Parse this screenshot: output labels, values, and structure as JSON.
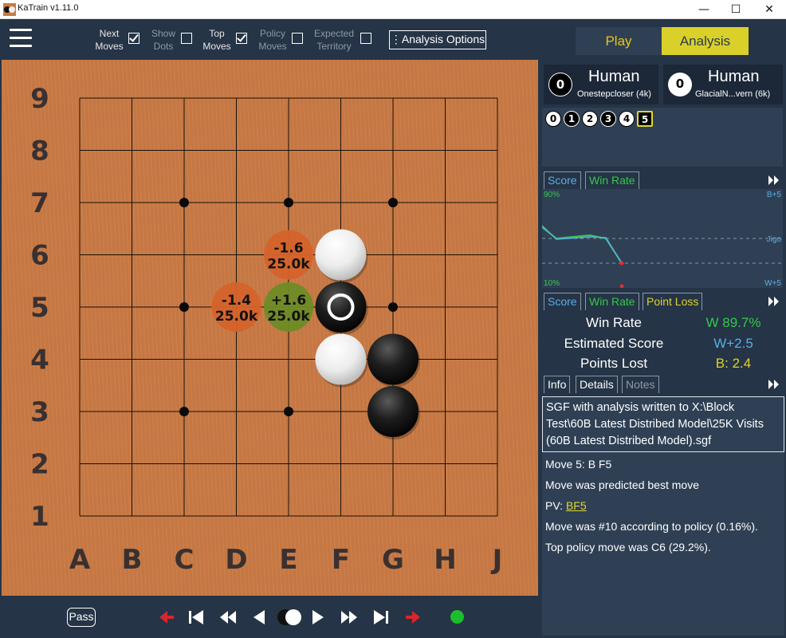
{
  "window": {
    "title": "KaTrain v1.11.0",
    "minimize": "—",
    "maximize": "☐",
    "close": "✕"
  },
  "toolbar": {
    "toggles": [
      {
        "line1": "Next",
        "line2": "Moves",
        "checked": true
      },
      {
        "line1": "Show",
        "line2": "Dots",
        "checked": false
      },
      {
        "line1": "Top",
        "line2": "Moves",
        "checked": true
      },
      {
        "line1": "Policy",
        "line2": "Moves",
        "checked": false
      },
      {
        "line1": "Expected",
        "line2": "Territory",
        "checked": false
      }
    ],
    "analysis_options": "⋮Analysis Options",
    "mode_tabs": {
      "play": "Play",
      "analysis": "Analysis"
    }
  },
  "board": {
    "size": 9,
    "col_labels": [
      "A",
      "B",
      "C",
      "D",
      "E",
      "F",
      "G",
      "H",
      "J"
    ],
    "row_labels": [
      "9",
      "8",
      "7",
      "6",
      "5",
      "4",
      "3",
      "2",
      "1"
    ],
    "star_points": [
      "C7",
      "E7",
      "G7",
      "C5",
      "G5",
      "C3",
      "E3"
    ],
    "stones": [
      {
        "point": "F6",
        "color": "white"
      },
      {
        "point": "F5",
        "color": "black",
        "last_move": true
      },
      {
        "point": "F4",
        "color": "white"
      },
      {
        "point": "G4",
        "color": "black"
      },
      {
        "point": "G3",
        "color": "black"
      }
    ],
    "candidate_moves": [
      {
        "point": "E6",
        "score": "-1.6",
        "visits": "25.0k",
        "color": "#d5632b"
      },
      {
        "point": "D5",
        "score": "-1.4",
        "visits": "25.0k",
        "color": "#d5632b"
      },
      {
        "point": "E5",
        "score": "+1.6",
        "visits": "25.0k",
        "color": "#6d8c26"
      }
    ]
  },
  "bottom": {
    "pass": "Pass"
  },
  "players": {
    "black": {
      "captures": "0",
      "type": "Human",
      "name": "Onestepcloser (4k)"
    },
    "white": {
      "captures": "0",
      "type": "Human",
      "name": "GlacialN...vern (6k)"
    }
  },
  "move_tree": [
    "0",
    "1",
    "2",
    "3",
    "4",
    "5"
  ],
  "graph": {
    "tabs": [
      "Score",
      "Win Rate"
    ],
    "top_left": "90%",
    "bottom_left": "10%",
    "top_right": "B+5",
    "mid_right": "Jigo",
    "bottom_right": "W+5"
  },
  "stats": {
    "tabs": [
      "Score",
      "Win Rate",
      "Point Loss"
    ],
    "rows": [
      {
        "label": "Win Rate",
        "value": "W 89.7%",
        "color": "#35c84a"
      },
      {
        "label": "Estimated Score",
        "value": "W+2.5",
        "color": "#5aaee6"
      },
      {
        "label": "Points Lost",
        "value": "B: 2.4",
        "color": "#e0d32a"
      }
    ]
  },
  "info": {
    "tabs": [
      "Info",
      "Details",
      "Notes"
    ],
    "sgf_message": "SGF with analysis written to X:\\Block Test\\60B Latest Distribed Model\\25K Visits (60B Latest Distribed Model).sgf",
    "move_line": "Move 5: B F5",
    "predicted": "Move was predicted best move",
    "pv_label": "PV:",
    "pv_value": "BF5",
    "policy_rank": "Move was #10 according to policy  (0.16%).",
    "top_policy": "Top policy move was C6 (29.2%)."
  }
}
